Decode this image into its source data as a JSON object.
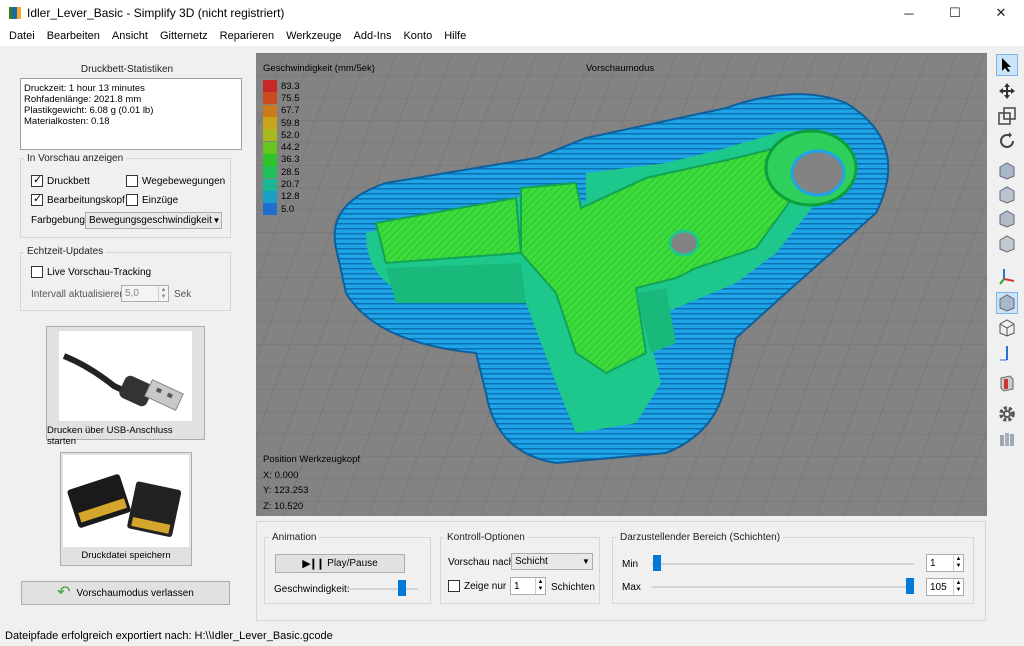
{
  "window": {
    "title": "Idler_Lever_Basic - Simplify 3D (nicht registriert)",
    "minimize": "─",
    "maximize": "☐",
    "close": "✕"
  },
  "menu": [
    "Datei",
    "Bearbeiten",
    "Ansicht",
    "Gitternetz",
    "Reparieren",
    "Werkzeuge",
    "Add-Ins",
    "Konto",
    "Hilfe"
  ],
  "stats": {
    "title": "Druckbett-Statistiken",
    "lines": [
      "Druckzeit: 1 hour 13 minutes",
      "Rohfadenlänge: 2021.8 mm",
      "Plastikgewicht: 6.08 g (0.01 lb)",
      "Materialkosten: 0.18"
    ]
  },
  "preview": {
    "title": "In Vorschau anzeigen",
    "druckbett": "Druckbett",
    "wegebewegungen": "Wegebewegungen",
    "bearbeitungskopf": "Bearbeitungskopf",
    "einzuege": "Einzüge",
    "farbgebung_label": "Farbgebung",
    "farbgebung_value": "Bewegungsgeschwindigkeit"
  },
  "realtime": {
    "title": "Echtzeit-Updates",
    "live": "Live Vorschau-Tracking",
    "interval_label": "Intervall aktualisieren",
    "interval_value": "5,0",
    "interval_unit": "Sek"
  },
  "usb": {
    "label": "Drucken über USB-Anschluss starten"
  },
  "sd": {
    "label": "Druckdatei speichern"
  },
  "exit": {
    "label": "Vorschaumodus verlassen"
  },
  "viewport": {
    "legend_title": "Geschwindigkeit (mm/5ek)",
    "mode": "Vorschaumodus",
    "legend": [
      {
        "value": "83.3",
        "color": "#c62828"
      },
      {
        "value": "75.5",
        "color": "#cc4a1f"
      },
      {
        "value": "67.7",
        "color": "#cc7a1a"
      },
      {
        "value": "59.8",
        "color": "#c9a418"
      },
      {
        "value": "52.0",
        "color": "#a8b91a"
      },
      {
        "value": "44.2",
        "color": "#66c51e"
      },
      {
        "value": "36.3",
        "color": "#2fc42a"
      },
      {
        "value": "28.5",
        "color": "#1fc05a"
      },
      {
        "value": "20.7",
        "color": "#17b893"
      },
      {
        "value": "12.8",
        "color": "#1a9fc7"
      },
      {
        "value": "5.0",
        "color": "#1f6fd1"
      }
    ],
    "position_title": "Position Werkzeugkopf",
    "x": "X: 0.000",
    "y": "Y: 123.253",
    "z": "Z: 10.520"
  },
  "animation": {
    "title": "Animation",
    "play": "Play/Pause",
    "speed_label": "Geschwindigkeit:",
    "speed_fraction": 0.78
  },
  "control": {
    "title": "Kontroll-Optionen",
    "preview_by": "Vorschau nach",
    "preview_value": "Schicht",
    "show_only": "Zeige nur",
    "show_value": "1",
    "layers": "Schichten"
  },
  "range": {
    "title": "Darzustellender Bereich (Schichten)",
    "min_label": "Min",
    "max_label": "Max",
    "min_value": "1",
    "max_value": "105"
  },
  "status": "Dateipfade erfolgreich exportiert nach: H:\\\\Idler_Lever_Basic.gcode",
  "colors": {
    "accent": "#0078d7",
    "infill": "#3ddc3d",
    "perimeter": "#1fa4e8"
  },
  "toolbar_icons": [
    "pointer-icon",
    "move-icon",
    "scale-icon",
    "rotate-icon",
    "view-cube-icon",
    "view-front-icon",
    "view-side-icon",
    "view-top-icon",
    "axes-icon",
    "view-iso-icon",
    "wireframe-icon",
    "axis-z-icon",
    "cross-section-icon",
    "settings-icon",
    "gallery-icon"
  ]
}
